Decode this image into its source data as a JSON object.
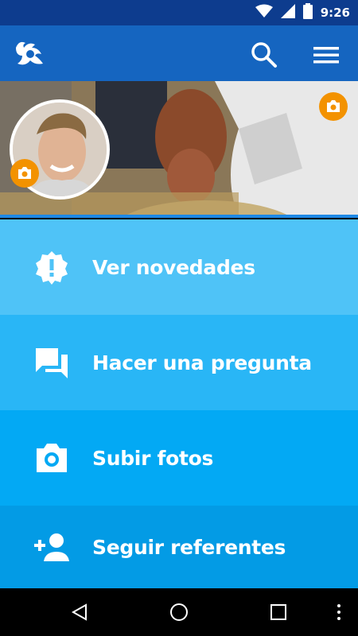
{
  "status_bar": {
    "time": "9:26",
    "icons": [
      "wifi-icon",
      "signal-icon",
      "battery-icon"
    ]
  },
  "app_bar": {
    "logo": "app-logo",
    "actions": [
      "search-icon",
      "menu-icon"
    ],
    "color": "#1565c0"
  },
  "profile": {
    "avatar_camera": "camera-icon",
    "cover_camera": "camera-icon",
    "accent": "#f39200"
  },
  "menu": {
    "items": [
      {
        "label": "Ver novedades",
        "icon": "alert-badge-icon"
      },
      {
        "label": "Hacer una pregunta",
        "icon": "chat-icon"
      },
      {
        "label": "Subir fotos",
        "icon": "camera-icon"
      },
      {
        "label": "Seguir referentes",
        "icon": "add-person-icon"
      }
    ]
  },
  "nav_bar": {
    "buttons": [
      "back-icon",
      "home-icon",
      "recents-icon",
      "more-icon"
    ]
  }
}
